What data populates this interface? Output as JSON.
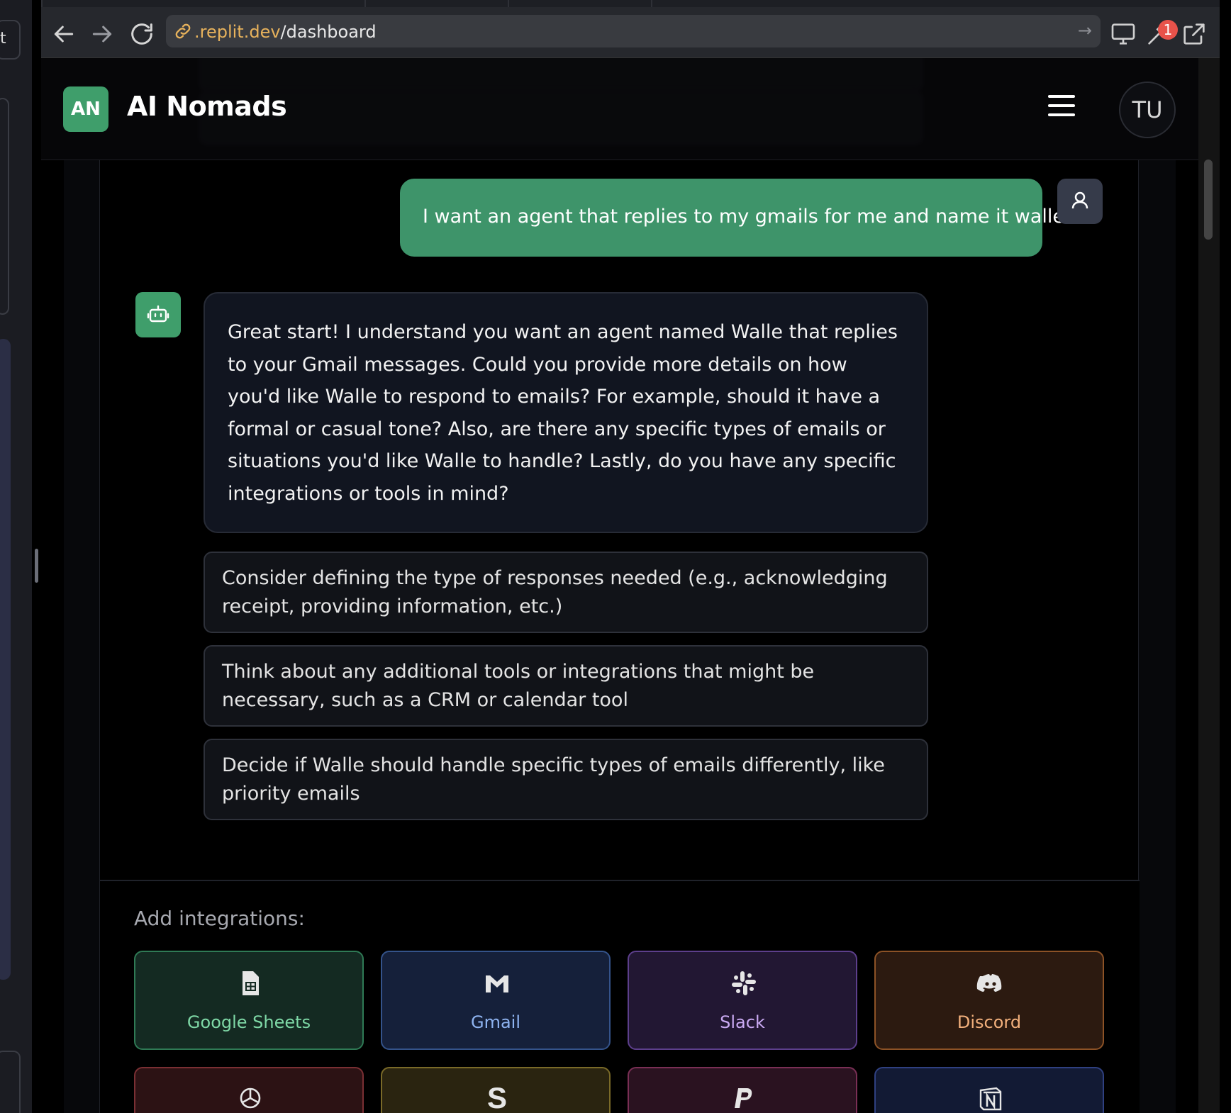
{
  "browser": {
    "url_prefix": ".replit.dev",
    "url_path": "/dashboard",
    "notification_count": "1"
  },
  "side_strip": {
    "button_text": "t"
  },
  "header": {
    "logo_initials": "AN",
    "app_name": "AI Nomads",
    "user_initials": "TU"
  },
  "chat": {
    "user_message": "I want an agent that replies to my gmails for me and name it walle",
    "assistant_message": "Great start! I understand you want an agent named Walle that replies to your Gmail messages. Could you provide more details on how you'd like Walle to respond to emails? For example, should it have a formal or casual tone? Also, are there any specific types of emails or situations you'd like Walle to handle? Lastly, do you have any specific integrations or tools in mind?",
    "suggestions": [
      "Consider defining the type of responses needed (e.g., acknowledging receipt, providing information, etc.)",
      "Think about any additional tools or integrations that might be necessary, such as a CRM or calendar tool",
      "Decide if Walle should handle specific types of emails differently, like priority emails"
    ]
  },
  "integrations": {
    "label": "Add integrations:",
    "items": [
      {
        "name": "Google Sheets",
        "icon": "google-sheets-icon",
        "bg": "#142a22",
        "border": "#2f7a55",
        "text": "#7ed8a6"
      },
      {
        "name": "Gmail",
        "icon": "gmail-icon",
        "bg": "#15203a",
        "border": "#34538a",
        "text": "#8eb3f0"
      },
      {
        "name": "Slack",
        "icon": "slack-icon",
        "bg": "#221733",
        "border": "#5d3f8c",
        "text": "#c9a9f2"
      },
      {
        "name": "Discord",
        "icon": "discord-icon",
        "bg": "#2c1a10",
        "border": "#8c5226",
        "text": "#f2b07c"
      },
      {
        "name": "",
        "icon": "openai-icon",
        "bg": "#2c1214",
        "border": "#7a2f33",
        "text": "#f0a0a0"
      },
      {
        "name": "",
        "icon": "stripe-icon",
        "bg": "#2a2410",
        "border": "#7a6a28",
        "text": "#f0d98a"
      },
      {
        "name": "",
        "icon": "paypal-icon",
        "bg": "#2a1220",
        "border": "#7a2f55",
        "text": "#f0a0c9"
      },
      {
        "name": "",
        "icon": "notion-icon",
        "bg": "#121a34",
        "border": "#2f4080",
        "text": "#a0b4f0"
      }
    ]
  }
}
